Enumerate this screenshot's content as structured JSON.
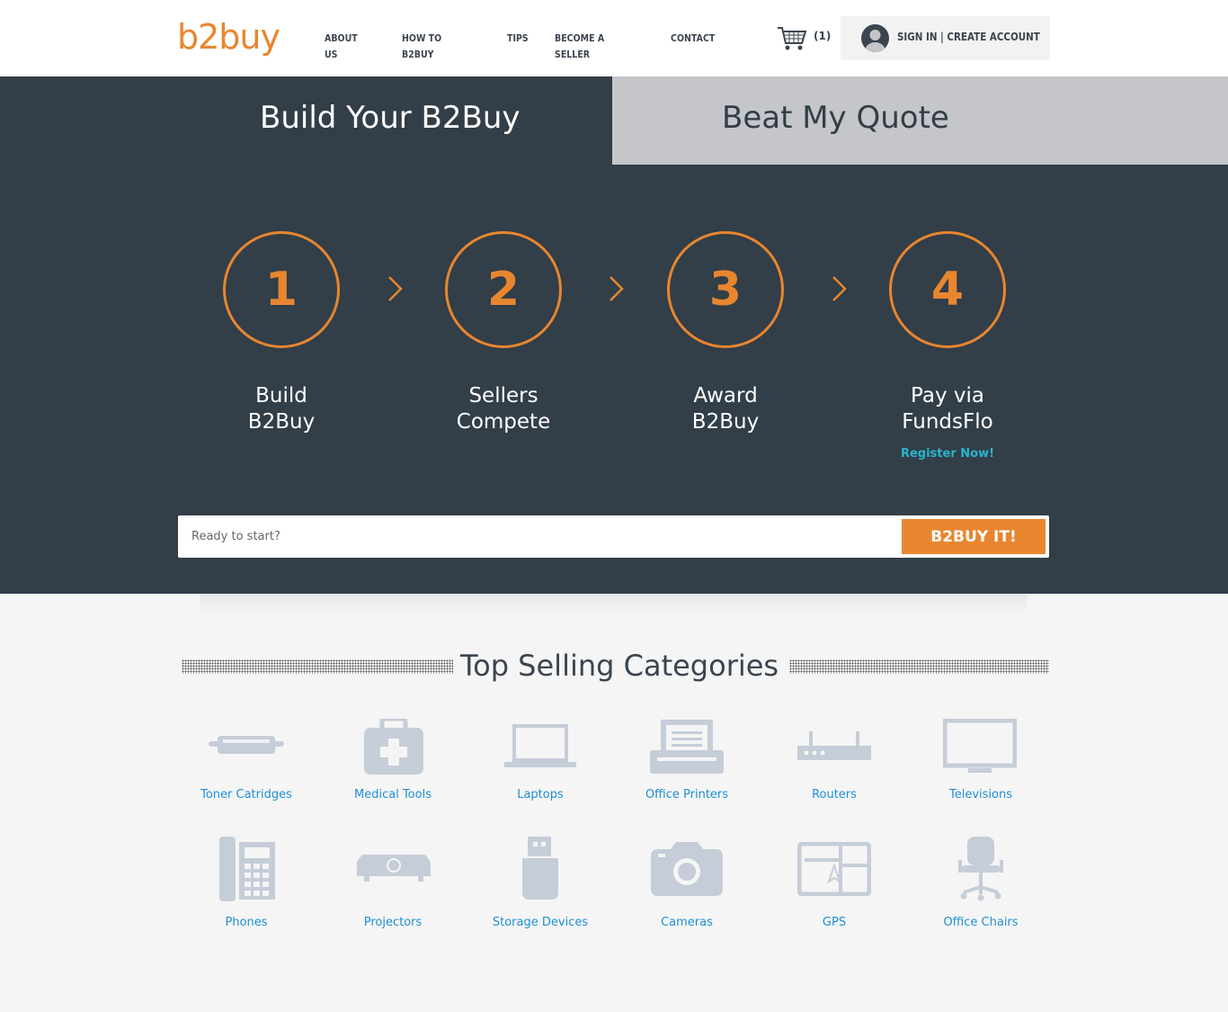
{
  "brand": {
    "logo_text": "b2buy",
    "accent": "#e8862f",
    "dark": "#323e48",
    "link": "#1e8fd6"
  },
  "nav": {
    "items": [
      "ABOUT US",
      "HOW TO B2BUY",
      "TIPS",
      "BECOME A SELLER",
      "CONTACT"
    ],
    "cart_icon": "shopping-cart-icon",
    "cart_count": "(1)",
    "account_label": "SIGN IN | CREATE ACCOUNT",
    "avatar_icon": "user-avatar-icon"
  },
  "tabs": {
    "build": "Build Your B2Buy",
    "beat": "Beat My Quote"
  },
  "steps": [
    {
      "num": "1",
      "line1": "Build",
      "line2": "B2Buy"
    },
    {
      "num": "2",
      "line1": "Sellers",
      "line2": "Compete"
    },
    {
      "num": "3",
      "line1": "Award",
      "line2": "B2Buy"
    },
    {
      "num": "4",
      "line1": "Pay via",
      "line2": "FundsFlo"
    }
  ],
  "register_link": "Register Now!",
  "search": {
    "placeholder": "Ready to start?",
    "button": "B2BUY IT!"
  },
  "categories": {
    "title": "Top Selling Categories",
    "items": [
      {
        "label": "Toner Catridges",
        "icon": "toner-cartridge-icon"
      },
      {
        "label": "Medical Tools",
        "icon": "medical-kit-icon"
      },
      {
        "label": "Laptops",
        "icon": "laptop-icon"
      },
      {
        "label": "Office Printers",
        "icon": "printer-icon"
      },
      {
        "label": "Routers",
        "icon": "router-icon"
      },
      {
        "label": "Televisions",
        "icon": "television-icon"
      },
      {
        "label": "Phones",
        "icon": "desk-phone-icon"
      },
      {
        "label": "Projectors",
        "icon": "projector-icon"
      },
      {
        "label": "Storage Devices",
        "icon": "usb-drive-icon"
      },
      {
        "label": "Cameras",
        "icon": "camera-icon"
      },
      {
        "label": "GPS",
        "icon": "gps-device-icon"
      },
      {
        "label": "Office Chairs",
        "icon": "office-chair-icon"
      }
    ]
  }
}
